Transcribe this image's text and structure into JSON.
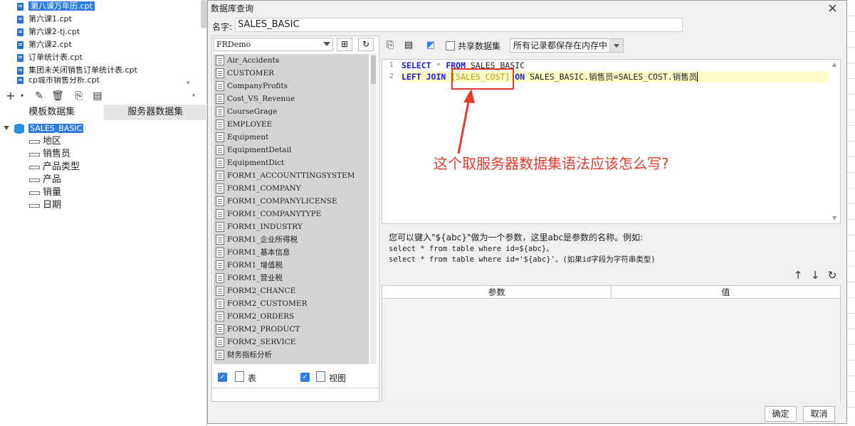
{
  "file_list": [
    {
      "label": "第八课万年历.cpt",
      "selected": true
    },
    {
      "label": "第六课1.cpt",
      "selected": false
    },
    {
      "label": "第六课2-tj.cpt",
      "selected": false
    },
    {
      "label": "第六课2.cpt",
      "selected": false
    },
    {
      "label": "订单统计表.cpt",
      "selected": false
    },
    {
      "label": "集团未关闭销售订单统计表.cpt",
      "selected": false
    },
    {
      "label": "cp城市销售分析.cpt",
      "selected": false
    }
  ],
  "dataset_tabs": {
    "template": "模板数据集",
    "server": "服务器数据集"
  },
  "tree": {
    "root": "SALES_BASIC",
    "fields": [
      "地区",
      "销售员",
      "产品类型",
      "产品",
      "销量",
      "日期"
    ]
  },
  "dialog": {
    "title": "数据库查询",
    "name_label": "名字:",
    "name_value": "SALES_BASIC",
    "ok": "确定",
    "cancel": "取消"
  },
  "db_panel": {
    "connection": "FRDemo",
    "tables": [
      "Air_Accidents",
      "CUSTOMER",
      "CompanyProfits",
      "Cost_VS_Revenue",
      "CourseGrage",
      "EMPLOYEE",
      "Equipment",
      "EquipmentDetail",
      "EquipmentDict",
      "FORM1_ACCOUNTTINGSYSTEM",
      "FORM1_COMPANY",
      "FORM1_COMPANYLICENSE",
      "FORM1_COMPANYTYPE",
      "FORM1_INDUSTRY",
      "FORM1_企业所得税",
      "FORM1_基本信息",
      "FORM1_增值税",
      "FORM1_营业税",
      "FORM2_CHANCE",
      "FORM2_CUSTOMER",
      "FORM2_ORDERS",
      "FORM2_PRODUCT",
      "FORM2_SERVICE",
      "财务指标分析"
    ],
    "check_table": "表",
    "check_view": "视图"
  },
  "sql_toolbar": {
    "share_label": "共享数据集",
    "memory_option": "所有记录都保存在内存中"
  },
  "editor": {
    "line_numbers": [
      "1",
      "2"
    ],
    "line1": {
      "kw1": "SELECT",
      "star": " * ",
      "kw2": "FROM",
      "rest": " SALES_BASIC"
    },
    "line2": {
      "kw1": "LEFT JOIN",
      "table": "[SALES_COST]",
      "kw2": "ON",
      "rest": " SALES_BASIC.销售员=SALES_COST.销售员"
    },
    "annotation": "这个取服务器数据集语法应该怎么写?"
  },
  "hint": {
    "line1": "您可以键入\"${abc}\"做为一个参数，这里abc是参数的名称。例如:",
    "line2": "select * from table where id=${abc}。",
    "line3": "select * from table where id='${abc}'。(如果id字段为字符串类型)"
  },
  "param_table": {
    "col_param": "参数",
    "col_value": "值"
  }
}
